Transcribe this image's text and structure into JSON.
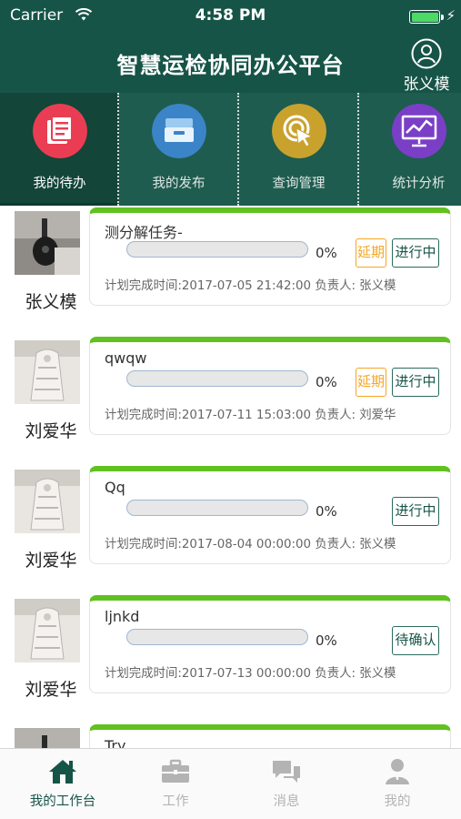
{
  "status_bar": {
    "carrier": "Carrier",
    "time": "4:58 PM"
  },
  "header": {
    "title": "智慧运检协同办公平台",
    "user_name": "张义模",
    "user_icon": "user-circle-icon"
  },
  "categories": [
    {
      "label": "我的待办",
      "icon": "todo-list-icon",
      "color": "#ea3d53",
      "active": true
    },
    {
      "label": "我的发布",
      "icon": "inbox-tray-icon",
      "color": "#3b84c8",
      "active": false
    },
    {
      "label": "查询管理",
      "icon": "target-cursor-icon",
      "color": "#c9a22e",
      "active": false
    },
    {
      "label": "统计分析",
      "icon": "chart-board-icon",
      "color": "#7a3fc6",
      "active": false
    }
  ],
  "tasks": [
    {
      "assignee": "张义模",
      "title": "测分解任务-",
      "progress": 0,
      "progress_label": "0%",
      "delay_label": "延期",
      "status_label": "进行中",
      "meta": "计划完成时间:2017-07-05 21:42:00  负责人:  张义模"
    },
    {
      "assignee": "刘爱华",
      "title": "qwqw",
      "progress": 0,
      "progress_label": "0%",
      "delay_label": "延期",
      "status_label": "进行中",
      "meta": "计划完成时间:2017-07-11 15:03:00  负责人:  刘爱华"
    },
    {
      "assignee": "刘爱华",
      "title": "Qq",
      "progress": 0,
      "progress_label": "0%",
      "delay_label": "",
      "status_label": "进行中",
      "meta": "计划完成时间:2017-08-04 00:00:00  负责人:  张义模"
    },
    {
      "assignee": "刘爱华",
      "title": "ljnkd",
      "progress": 0,
      "progress_label": "0%",
      "delay_label": "",
      "status_label": "待确认",
      "meta": "计划完成时间:2017-07-13 00:00:00  负责人:  张义模"
    },
    {
      "assignee": "",
      "title": "Try",
      "progress": 0,
      "progress_label": "",
      "delay_label": "",
      "status_label": "",
      "meta": ""
    }
  ],
  "tabbar": [
    {
      "label": "我的工作台",
      "icon": "home-icon",
      "active": true
    },
    {
      "label": "工作",
      "icon": "briefcase-icon",
      "active": false
    },
    {
      "label": "消息",
      "icon": "chat-bubbles-icon",
      "active": false
    },
    {
      "label": "我的",
      "icon": "person-icon",
      "active": false
    }
  ],
  "colors": {
    "header": "#165447",
    "accent_green": "#61c120",
    "delay_orange": "#f5a623",
    "status_green": "#165447"
  }
}
